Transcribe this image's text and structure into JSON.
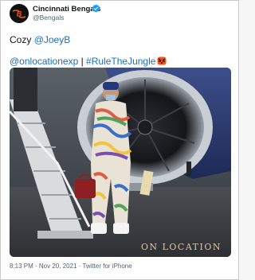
{
  "tweet": {
    "author": {
      "name": "Cincinnati Bengals",
      "handle": "@Bengals",
      "avatar_icon": "bengals-logo-icon",
      "verified_icon": "verified-badge-icon"
    },
    "text_prefix": "Cozy ",
    "mention": "@JoeyB",
    "line2_link1": "@onlocationexp",
    "separator": " | ",
    "line2_hashtag": "#RuleTheJungle",
    "emoji_icon": "bengals-tiger-icon",
    "media": {
      "watermark": "On Location"
    },
    "timestamp": "8:13 PM · Nov 20, 2021 · Twitter for iPhone"
  },
  "colors": {
    "link": "#1d6fb8",
    "bengals_orange": "#fb4f14",
    "verified": "#1d9bf0"
  }
}
